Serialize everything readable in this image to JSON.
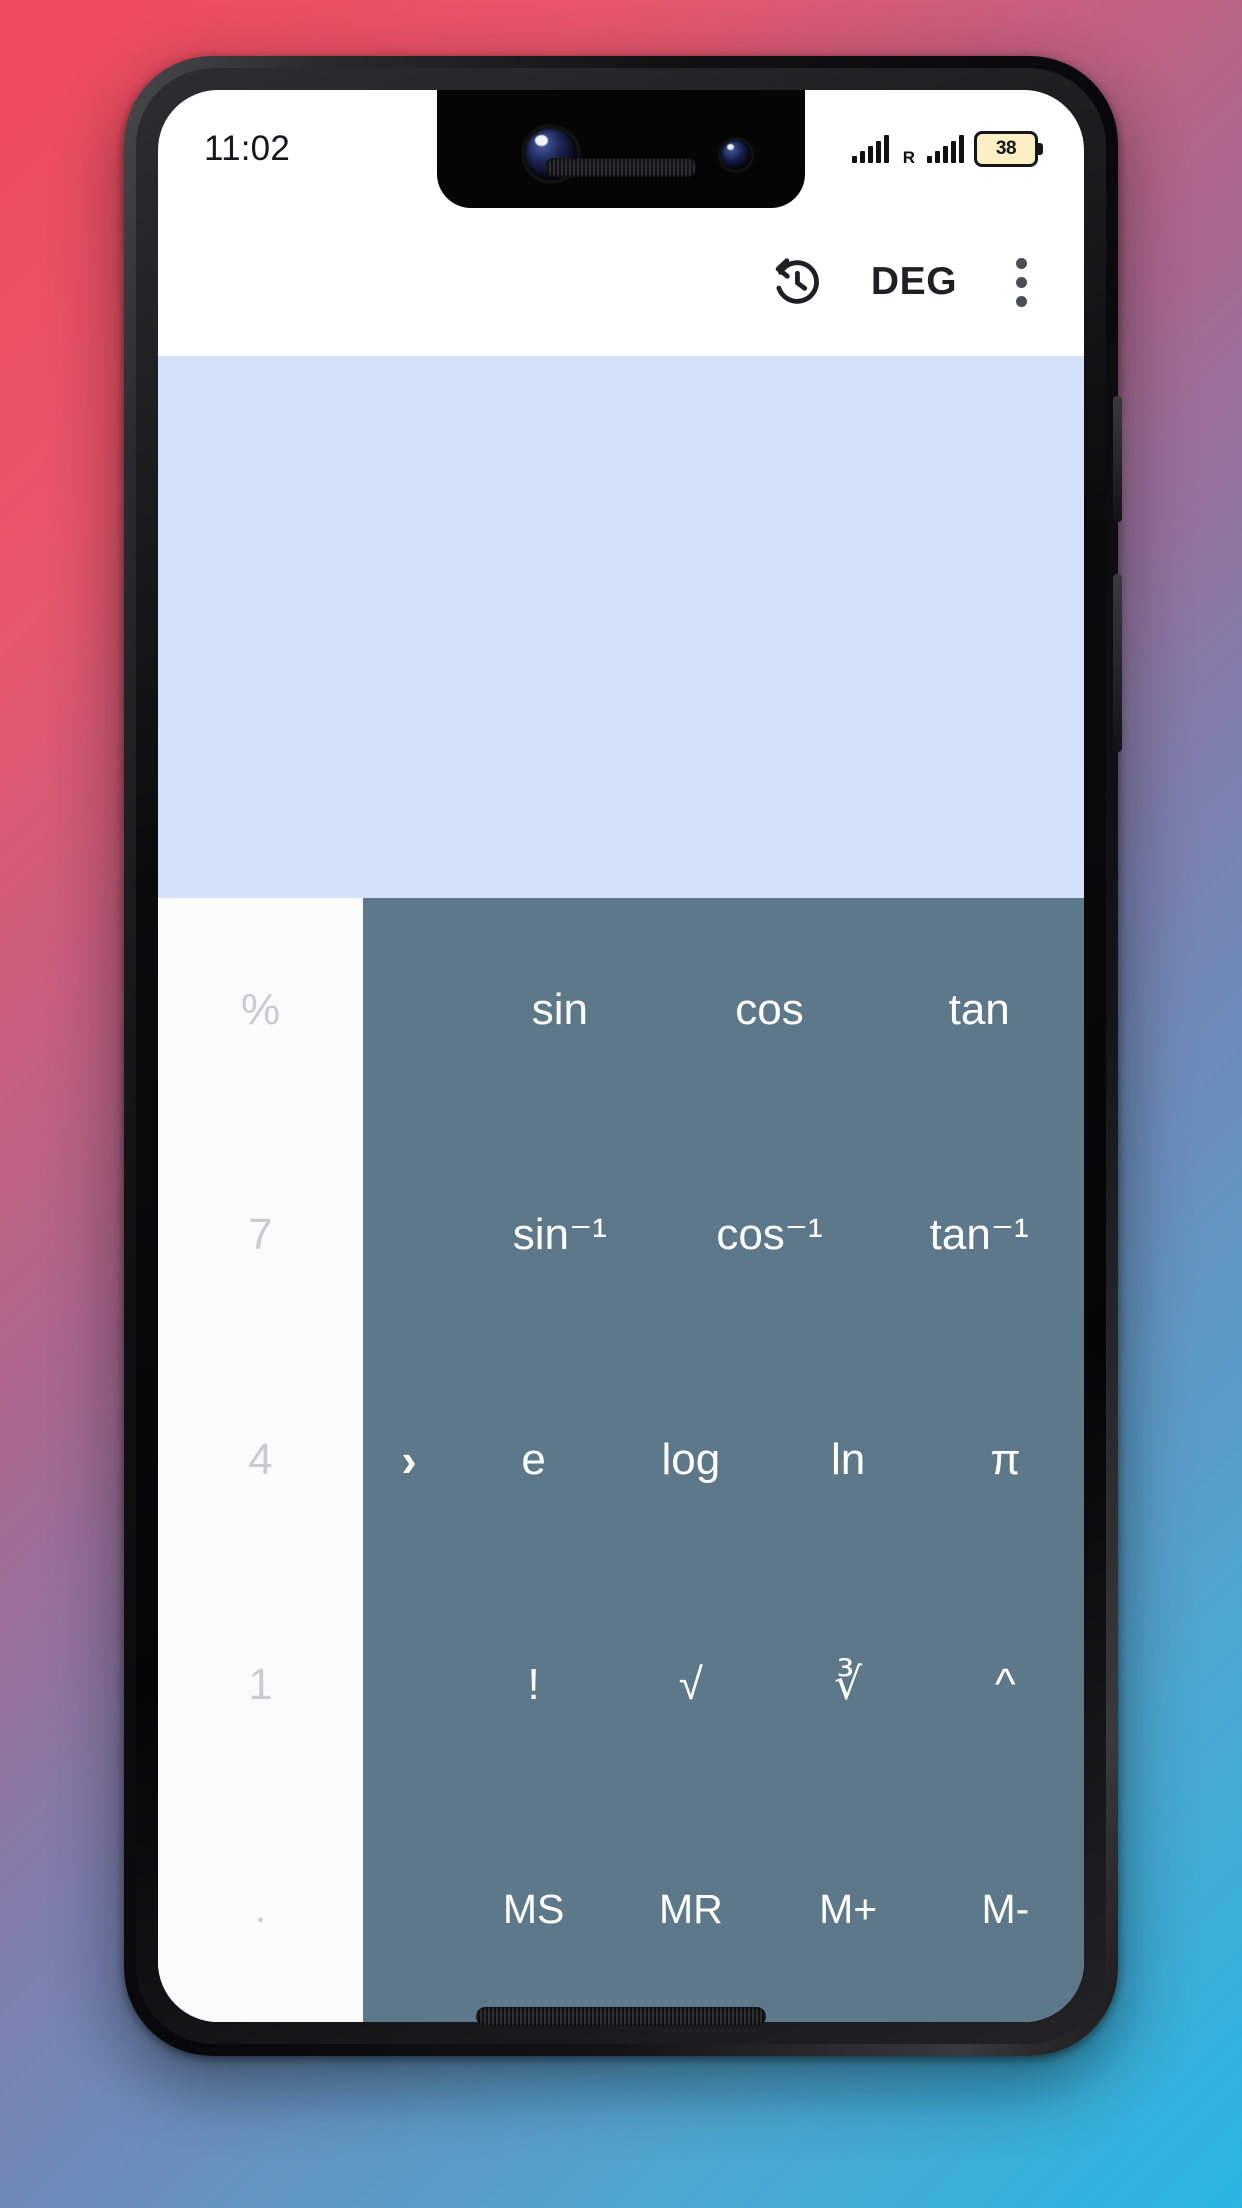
{
  "status_bar": {
    "clock": "11:02",
    "signal_icon": "signal-bars-icon",
    "roaming_label": "R",
    "roaming_signal_icon": "roaming-signal-bars-icon",
    "battery_icon": "battery-icon",
    "battery_level": "38",
    "battery_fill_color": "#fbefc3"
  },
  "toolbar": {
    "history_icon": "history-icon",
    "angle_mode": "DEG",
    "overflow_icon": "overflow-menu-icon"
  },
  "display": {
    "background_color": "#d3e1fb",
    "expression": "",
    "result": ""
  },
  "keypad": {
    "numeric_column_bg": "#fafcfb",
    "scientific_panel_bg": "#5c7889",
    "numeric_keys": [
      "%",
      "7",
      "4",
      "1",
      "."
    ],
    "expand_chevron": "›",
    "rows": [
      {
        "keys": [
          "sin",
          "cos",
          "tan"
        ]
      },
      {
        "keys": [
          "sin⁻¹",
          "cos⁻¹",
          "tan⁻¹"
        ]
      },
      {
        "keys": [
          "e",
          "log",
          "ln",
          "π"
        ]
      },
      {
        "keys": [
          "!",
          "√",
          "∛",
          "^"
        ]
      },
      {
        "keys": [
          "MS",
          "MR",
          "M+",
          "M-"
        ]
      }
    ]
  },
  "wallpaper": {
    "gradient_start": "#ef4a5e",
    "gradient_end": "#27b5e0"
  }
}
